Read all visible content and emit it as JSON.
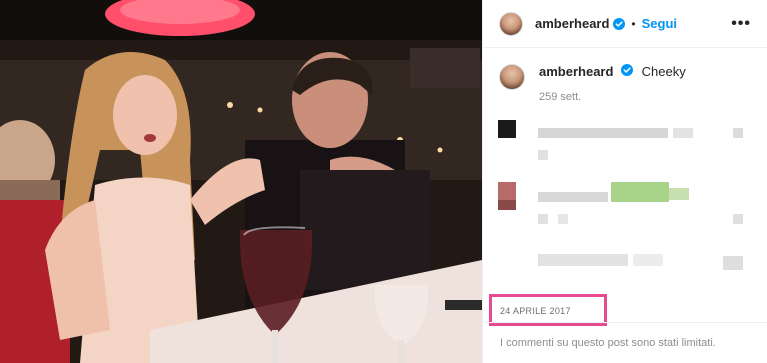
{
  "post": {
    "username": "amberheard",
    "follow_label": "Segui",
    "separator": "•",
    "more_label": "•••",
    "caption_text": "Cheeky",
    "age": "259 sett.",
    "date": "24 APRILE 2017",
    "comments_limited": "I commenti su questo post sono stati limitati."
  },
  "colors": {
    "accent": "#0095f6",
    "highlight_box": "#e64b91",
    "muted": "#8e8e8e"
  },
  "icons": {
    "verified": "verified-badge-icon",
    "more": "more-options-icon"
  }
}
